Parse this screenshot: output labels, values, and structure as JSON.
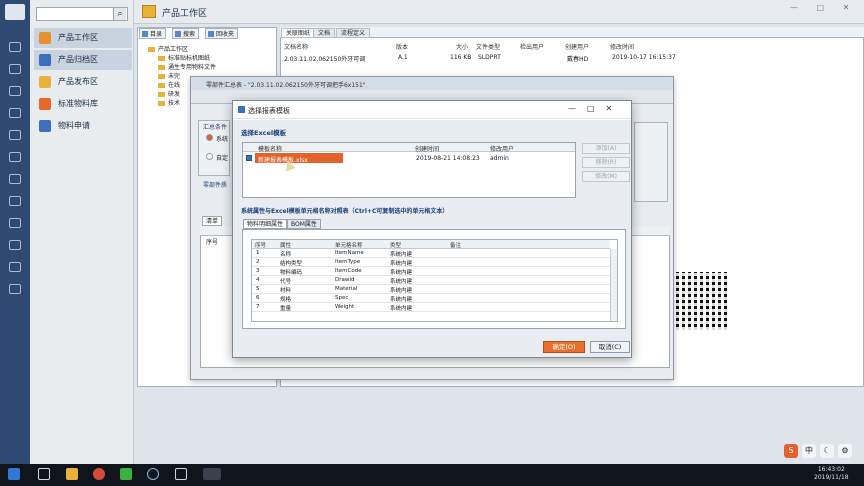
{
  "app": {
    "header_title": "产品工作区"
  },
  "nav": {
    "items": [
      {
        "label": "产品工作区",
        "color": "#e8902e",
        "selected": true
      },
      {
        "label": "产品归档区",
        "color": "#3b6fb8",
        "selected": true
      },
      {
        "label": "产品发布区",
        "color": "#e8b13a",
        "selected": false
      },
      {
        "label": "标准物料库",
        "color": "#e36a2a",
        "selected": false
      },
      {
        "label": "物料申请",
        "color": "#3b6fb8",
        "selected": false
      }
    ]
  },
  "left_toolbar": {
    "tabs": [
      "目录",
      "搜索",
      "回收夹"
    ]
  },
  "tree": {
    "root": "产品工作区",
    "nodes": [
      "标准贴标机图纸",
      "通生专用物料文件",
      "未完",
      "在线",
      "研发",
      "技术"
    ]
  },
  "right_panel": {
    "tabs": [
      "关联图纸",
      "文档",
      "流程定义"
    ],
    "columns": [
      "文档名称",
      "版本",
      "大小",
      "文件类型",
      "检出用户",
      "创建用户",
      "修改时间"
    ],
    "row": {
      "name": "2.03.11.02.062150外牙可调",
      "version": "A.1",
      "size": "116 KB",
      "type": "SLDPRT",
      "checkout": "",
      "creator": "戴春HD",
      "modified": "2019-10-17 16:15:37"
    }
  },
  "mid_window": {
    "title": "零部件汇总表 - \"2.03.11.02.062150外牙可调把手6x151\"",
    "group1_label": "汇总条件",
    "opt1": "系统",
    "opt2": "自定",
    "group2_label": "零部件质",
    "grid_tab": "清单",
    "grid_col": "序号"
  },
  "dialog": {
    "title": "选择报表模板",
    "section1": "选择Excel模板",
    "tpl_columns": [
      "模板名称",
      "创建时间",
      "修改用户"
    ],
    "tpl_row": {
      "name": "新建报表模板.xlsx",
      "created": "2019-08-21 14:08:23",
      "user": "admin"
    },
    "side_buttons": [
      "添加(A)",
      "移除(R)",
      "修改(M)"
    ],
    "section2": "系统属性与Excel模板单元格名称对照表（Ctrl+C可复制选中的单元格文本）",
    "tabs": [
      "物料明细属性",
      "BOM属性"
    ],
    "attr_columns": [
      "序号",
      "属性",
      "单元格名称",
      "类型",
      "备注"
    ],
    "attr_rows": [
      {
        "no": "1",
        "attr": "名称",
        "cell": "ItemName",
        "type": "系统内建"
      },
      {
        "no": "2",
        "attr": "结构类型",
        "cell": "ItemType",
        "type": "系统内建"
      },
      {
        "no": "3",
        "attr": "物料编码",
        "cell": "ItemCode",
        "type": "系统内建"
      },
      {
        "no": "4",
        "attr": "代号",
        "cell": "DrawId",
        "type": "系统内建"
      },
      {
        "no": "5",
        "attr": "材料",
        "cell": "Material",
        "type": "系统内建"
      },
      {
        "no": "6",
        "attr": "规格",
        "cell": "Spec",
        "type": "系统内建"
      },
      {
        "no": "7",
        "attr": "重量",
        "cell": "Weight",
        "type": "系统内建"
      }
    ],
    "ok_label": "确定(O)",
    "cancel_label": "取消(C)"
  },
  "tray": {
    "ime": "中",
    "clock_time": "16:43:02",
    "clock_date": "2019/11/18"
  },
  "colors": {
    "accent": "#e8702e",
    "sidebar": "#2e4a73",
    "highlight": "#e3622a"
  }
}
